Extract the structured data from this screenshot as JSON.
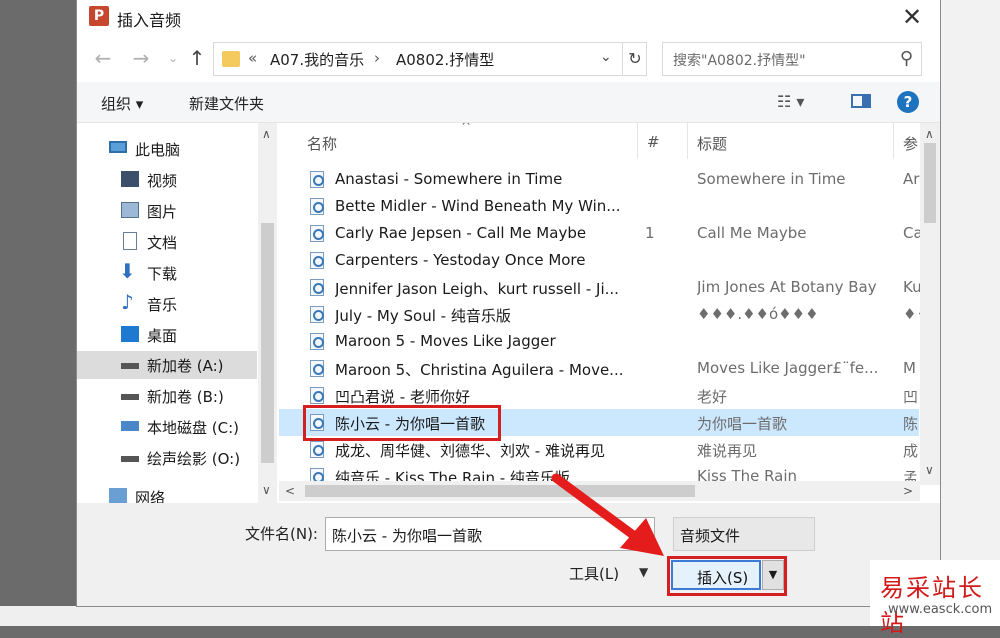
{
  "window": {
    "title": "插入音频",
    "app_icon": "P"
  },
  "address": {
    "overflow": "«",
    "crumbs": [
      "A07.我的音乐",
      "A0802.抒情型"
    ],
    "separator": "›"
  },
  "search": {
    "placeholder": "搜索\"A0802.抒情型\""
  },
  "toolbar": {
    "organize": "组织 ▾",
    "new_folder": "新建文件夹"
  },
  "nav": {
    "items": [
      {
        "label": "此电脑",
        "icon": "computer-icon"
      },
      {
        "label": "视频",
        "icon": "video-icon"
      },
      {
        "label": "图片",
        "icon": "picture-icon"
      },
      {
        "label": "文档",
        "icon": "document-icon"
      },
      {
        "label": "下载",
        "icon": "download-icon"
      },
      {
        "label": "音乐",
        "icon": "music-icon"
      },
      {
        "label": "桌面",
        "icon": "desktop-icon"
      },
      {
        "label": "新加卷 (A:)",
        "icon": "drive-icon",
        "selected": true
      },
      {
        "label": "新加卷 (B:)",
        "icon": "drive-icon"
      },
      {
        "label": "本地磁盘 (C:)",
        "icon": "system-drive-icon"
      },
      {
        "label": "绘声绘影 (O:)",
        "icon": "drive-icon"
      },
      {
        "label": "网络",
        "icon": "network-icon"
      }
    ]
  },
  "columns": {
    "name": "名称",
    "number": "#",
    "title": "标题",
    "artist": "参"
  },
  "files": [
    {
      "name": "Anastasi - Somewhere in Time",
      "number": "",
      "title": "Somewhere in Time",
      "artist": "Ar"
    },
    {
      "name": "Bette Midler - Wind Beneath My Win...",
      "number": "",
      "title": "",
      "artist": ""
    },
    {
      "name": "Carly Rae Jepsen - Call Me Maybe",
      "number": "1",
      "title": "Call Me Maybe",
      "artist": "Ca"
    },
    {
      "name": "Carpenters - Yestoday Once More",
      "number": "",
      "title": "",
      "artist": ""
    },
    {
      "name": "Jennifer Jason Leigh、kurt russell - Ji...",
      "number": "",
      "title": "Jim Jones At Botany Bay",
      "artist": "Ku"
    },
    {
      "name": "July - My Soul - 纯音乐版",
      "number": "",
      "title": "♦♦♦.♦♦ó♦♦♦",
      "artist": "♦♦"
    },
    {
      "name": "Maroon 5 - Moves Like Jagger",
      "number": "",
      "title": "",
      "artist": ""
    },
    {
      "name": "Maroon 5、Christina Aguilera - Move...",
      "number": "",
      "title": "Moves Like Jagger£¨fe...",
      "artist": "M"
    },
    {
      "name": "凹凸君说 - 老师你好",
      "number": "",
      "title": "老好",
      "artist": "凹"
    },
    {
      "name": "陈小云 - 为你唱一首歌",
      "number": "",
      "title": "为你唱一首歌",
      "artist": "陈",
      "selected": true
    },
    {
      "name": "成龙、周华健、刘德华、刘欢 - 难说再见",
      "number": "",
      "title": "难说再见",
      "artist": "成"
    },
    {
      "name": "纯音乐 - Kiss The Rain - 纯音乐版",
      "number": "",
      "title": "Kiss The Rain",
      "artist": "孟"
    }
  ],
  "footer": {
    "filename_label": "文件名(N):",
    "filename_value": "陈小云 - 为你唱一首歌",
    "filetype": "音频文件",
    "tools": "工具(L)",
    "insert": "插入(S)"
  },
  "watermark": {
    "title": "易采站长站",
    "url": "www.easck.com"
  },
  "colors": {
    "highlight_box": "#d42020",
    "selected_row": "#cce8ff",
    "selected_nav": "#dcdcdc",
    "accent": "#3d7bd6"
  }
}
